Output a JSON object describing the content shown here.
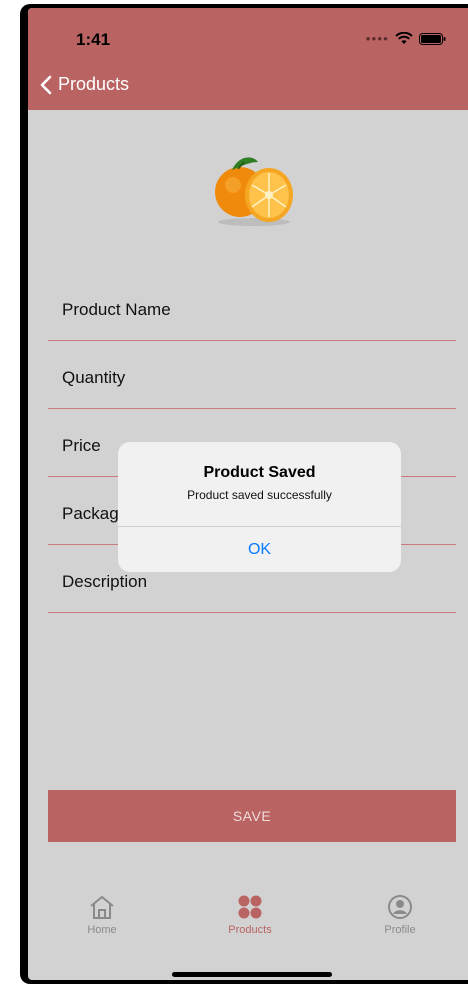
{
  "status_bar": {
    "time": "1:41"
  },
  "nav": {
    "back_label": "Products"
  },
  "form": {
    "fields": [
      {
        "label": "Product Name"
      },
      {
        "label": "Quantity"
      },
      {
        "label": "Price"
      },
      {
        "label": "Packag"
      },
      {
        "label": "Description"
      }
    ],
    "save_label": "SAVE"
  },
  "alert": {
    "title": "Product Saved",
    "message": "Product saved successfully",
    "ok_label": "OK"
  },
  "tabs": [
    {
      "label": "Home",
      "icon": "home-icon"
    },
    {
      "label": "Products",
      "icon": "grid-icon",
      "active": true
    },
    {
      "label": "Profile",
      "icon": "profile-icon"
    }
  ],
  "colors": {
    "accent": "#b96363",
    "alert_button": "#0a7aff",
    "background": "#d2d2d2"
  }
}
